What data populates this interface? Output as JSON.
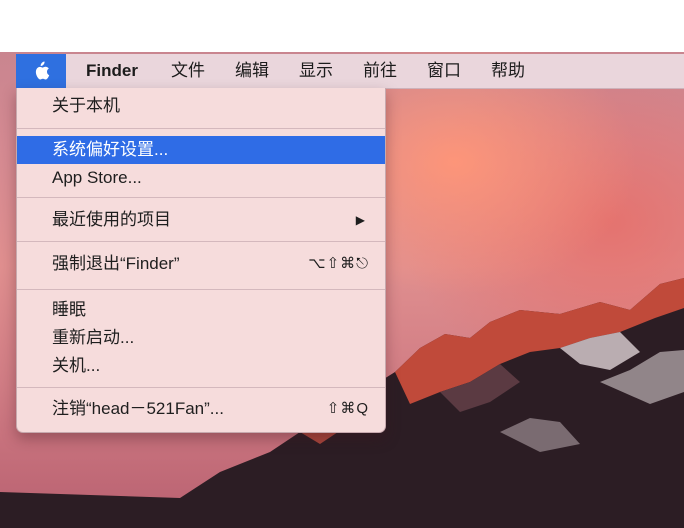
{
  "menubar": {
    "apple_icon": "apple-icon",
    "items": [
      "Finder",
      "文件",
      "编辑",
      "显示",
      "前往",
      "窗口",
      "帮助"
    ]
  },
  "apple_menu": {
    "items": [
      {
        "label": "关于本机"
      },
      {
        "label": "系统偏好设置...",
        "highlighted": true
      },
      {
        "label": "App Store..."
      },
      {
        "label": "最近使用的项目",
        "submenu_icon": "triangle-right-icon"
      },
      {
        "label": "强制退出“Finder”",
        "shortcut": "⌥⇧⌘⎋"
      },
      {
        "label": "睡眠"
      },
      {
        "label": "重新启动..."
      },
      {
        "label": "关机..."
      },
      {
        "label": "注销“head－521Fan”...",
        "shortcut": "⇧⌘Q"
      }
    ]
  },
  "colors": {
    "highlight": "#2f6ce6",
    "menu_background": "#f6dcdc",
    "menubar_background": "#ead6dc"
  }
}
